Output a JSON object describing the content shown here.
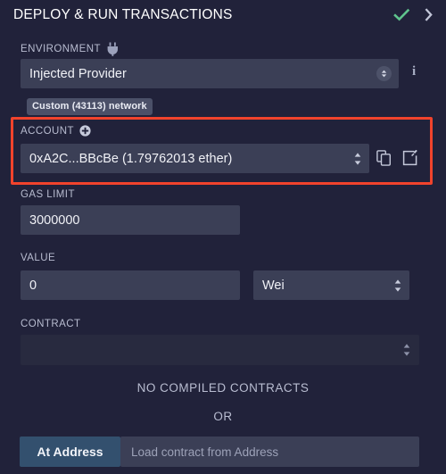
{
  "header": {
    "title": "DEPLOY & RUN TRANSACTIONS",
    "check_icon": "check-icon",
    "chevron_icon": "chevron-right-icon",
    "check_color": "#5fc48d",
    "chevron_color": "#c2c6d8"
  },
  "environment": {
    "label": "ENVIRONMENT",
    "icon": "plug-icon",
    "value": "Injected Provider",
    "info_icon": "info-icon",
    "info_label": "i",
    "spinner_icon": "select-spinner-icon",
    "network_badge": "Custom (43113) network"
  },
  "account": {
    "label": "ACCOUNT",
    "add_icon": "plus-circle-icon",
    "value": "0xA2C...BBcBe (1.79762013 ether)",
    "copy_icon": "copy-icon",
    "edit_icon": "edit-icon",
    "spinner_icon": "select-spinner-icon",
    "highlight_color": "#f1432c"
  },
  "gas_limit": {
    "label": "GAS LIMIT",
    "value": "3000000"
  },
  "value_section": {
    "label": "VALUE",
    "value": "0",
    "unit": "Wei",
    "spinner_icon": "select-spinner-icon"
  },
  "contract": {
    "label": "CONTRACT",
    "value": "",
    "spinner_icon": "select-spinner-icon"
  },
  "status": {
    "no_contracts": "NO COMPILED CONTRACTS",
    "or": "OR"
  },
  "at_address": {
    "button_label": "At Address",
    "placeholder": "Load contract from Address",
    "value": "",
    "button_color": "#33506e"
  },
  "colors": {
    "background": "#21223a",
    "input_background": "#3b3f56",
    "disabled_background": "#282a3f",
    "label_text": "#b8bcd0",
    "value_text": "#f0f1f6",
    "badge_background": "#4b5068"
  }
}
